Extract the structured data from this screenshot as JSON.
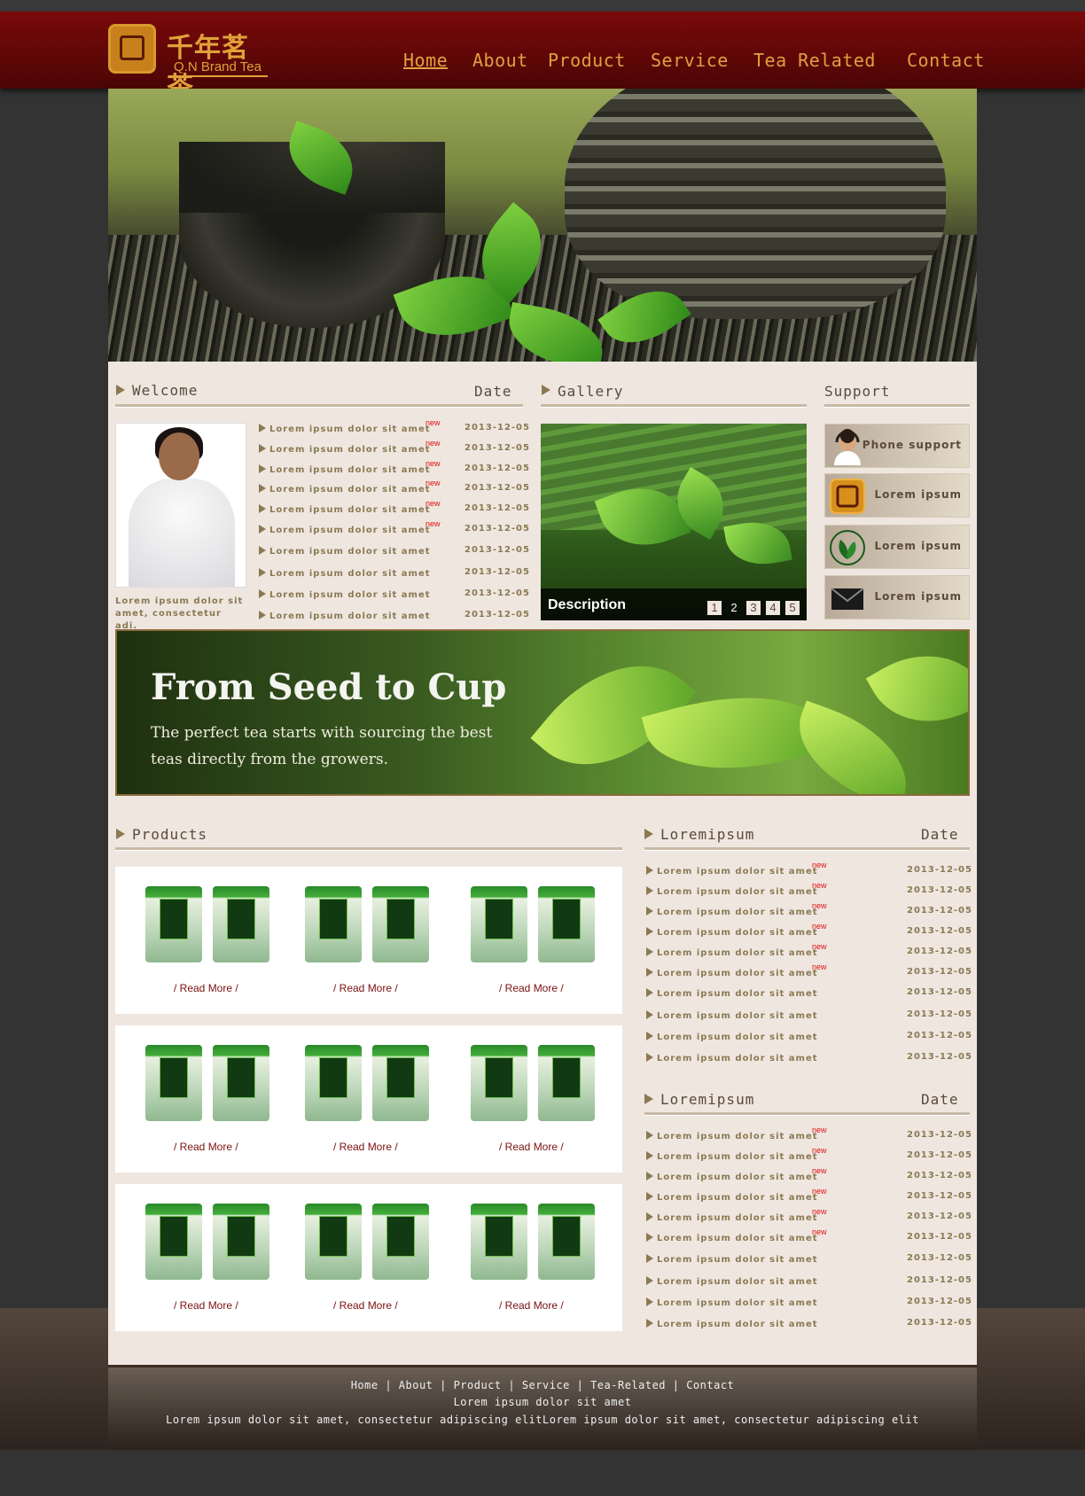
{
  "header": {
    "logo_cn": "千年茗茶",
    "logo_en": "Q.N Brand Tea",
    "nav": [
      "Home",
      "About",
      "Product",
      "Service",
      "Tea Related",
      "Contact"
    ]
  },
  "welcome": {
    "title": "Welcome",
    "date_label": "Date",
    "caption": "Lorem ipsum dolor sit amet, consectetur adi.",
    "items": [
      {
        "text": "Lorem ipsum dolor sit amet",
        "badge": "new",
        "date": "2013-12-05"
      },
      {
        "text": "Lorem ipsum dolor sit amet",
        "badge": "new",
        "date": "2013-12-05"
      },
      {
        "text": "Lorem ipsum dolor sit amet",
        "badge": "new",
        "date": "2013-12-05"
      },
      {
        "text": "Lorem ipsum dolor sit amet",
        "badge": "new",
        "date": "2013-12-05"
      },
      {
        "text": "Lorem ipsum dolor sit amet",
        "badge": "new",
        "date": "2013-12-05"
      },
      {
        "text": "Lorem ipsum dolor sit amet",
        "badge": "new",
        "date": "2013-12-05"
      },
      {
        "text": "Lorem ipsum dolor sit amet",
        "badge": "",
        "date": "2013-12-05"
      },
      {
        "text": "Lorem ipsum dolor sit amet",
        "badge": "",
        "date": "2013-12-05"
      },
      {
        "text": "Lorem ipsum dolor sit amet",
        "badge": "",
        "date": "2013-12-05"
      },
      {
        "text": "Lorem ipsum dolor sit amet",
        "badge": "",
        "date": "2013-12-05"
      }
    ]
  },
  "gallery": {
    "title": "Gallery",
    "description": "Description",
    "pages": [
      "1",
      "2",
      "3",
      "4",
      "5"
    ],
    "active_page": "2"
  },
  "support": {
    "title": "Support",
    "items": [
      {
        "label": "Phone support",
        "icon": "headset-icon"
      },
      {
        "label": "Lorem ipsum",
        "icon": "brand-logo-icon"
      },
      {
        "label": "Lorem ipsum",
        "icon": "tea-leaf-icon"
      },
      {
        "label": "Lorem ipsum",
        "icon": "mail-icon"
      }
    ]
  },
  "banner": {
    "heading": "From Seed to Cup",
    "text": "The perfect tea starts with sourcing the best teas directly from the growers."
  },
  "products": {
    "title": "Products",
    "read_more": "/ Read More /",
    "rows": 3,
    "cols": 3
  },
  "news1": {
    "title": "Loremipsum",
    "date_label": "Date",
    "items": [
      {
        "text": "Lorem ipsum dolor sit amet",
        "badge": "new",
        "date": "2013-12-05"
      },
      {
        "text": "Lorem ipsum dolor sit amet",
        "badge": "new",
        "date": "2013-12-05"
      },
      {
        "text": "Lorem ipsum dolor sit amet",
        "badge": "new",
        "date": "2013-12-05"
      },
      {
        "text": "Lorem ipsum dolor sit amet",
        "badge": "new",
        "date": "2013-12-05"
      },
      {
        "text": "Lorem ipsum dolor sit amet",
        "badge": "new",
        "date": "2013-12-05"
      },
      {
        "text": "Lorem ipsum dolor sit amet",
        "badge": "new",
        "date": "2013-12-05"
      },
      {
        "text": "Lorem ipsum dolor sit amet",
        "badge": "",
        "date": "2013-12-05"
      },
      {
        "text": "Lorem ipsum dolor sit amet",
        "badge": "",
        "date": "2013-12-05"
      },
      {
        "text": "Lorem ipsum dolor sit amet",
        "badge": "",
        "date": "2013-12-05"
      },
      {
        "text": "Lorem ipsum dolor sit amet",
        "badge": "",
        "date": "2013-12-05"
      }
    ]
  },
  "news2": {
    "title": "Loremipsum",
    "date_label": "Date",
    "items": [
      {
        "text": "Lorem ipsum dolor sit amet",
        "badge": "new",
        "date": "2013-12-05"
      },
      {
        "text": "Lorem ipsum dolor sit amet",
        "badge": "new",
        "date": "2013-12-05"
      },
      {
        "text": "Lorem ipsum dolor sit amet",
        "badge": "new",
        "date": "2013-12-05"
      },
      {
        "text": "Lorem ipsum dolor sit amet",
        "badge": "new",
        "date": "2013-12-05"
      },
      {
        "text": "Lorem ipsum dolor sit amet",
        "badge": "new",
        "date": "2013-12-05"
      },
      {
        "text": "Lorem ipsum dolor sit amet",
        "badge": "new",
        "date": "2013-12-05"
      },
      {
        "text": "Lorem ipsum dolor sit amet",
        "badge": "",
        "date": "2013-12-05"
      },
      {
        "text": "Lorem ipsum dolor sit amet",
        "badge": "",
        "date": "2013-12-05"
      },
      {
        "text": "Lorem ipsum dolor sit amet",
        "badge": "",
        "date": "2013-12-05"
      },
      {
        "text": "Lorem ipsum dolor sit amet",
        "badge": "",
        "date": "2013-12-05"
      }
    ]
  },
  "footer": {
    "links": "Home | About | Product | Service | Tea-Related | Contact",
    "line1": "Lorem ipsum dolor sit amet",
    "line2": "Lorem ipsum dolor sit amet, consectetur adipiscing elitLorem ipsum dolor sit amet, consectetur adipiscing elit"
  },
  "colors": {
    "header": "#6a0808",
    "nav_text": "#e0a040",
    "page_bg": "#efe6e0",
    "list_text": "#8a7a52",
    "badge_new": "#e01010",
    "read_more": "#7a1010"
  }
}
